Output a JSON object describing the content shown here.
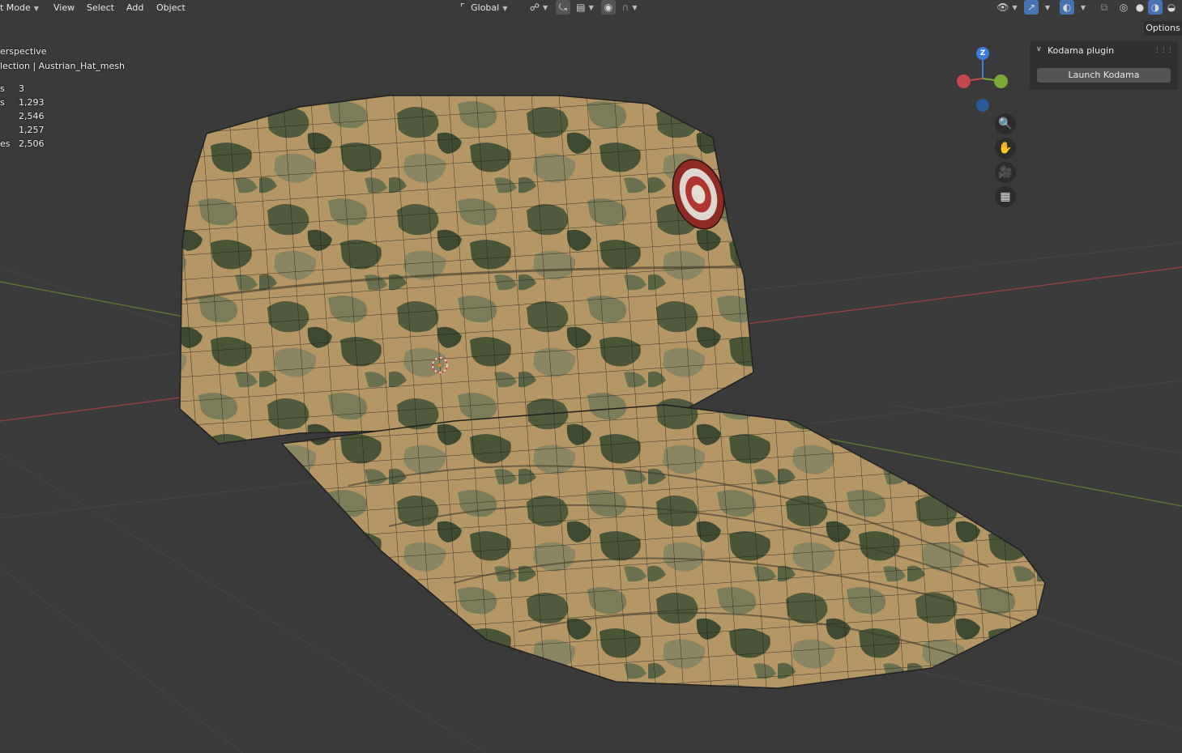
{
  "header": {
    "mode_label": "t Mode",
    "menus": [
      "View",
      "Select",
      "Add",
      "Object"
    ],
    "transform_orientation": "Global"
  },
  "viewport_info": {
    "view_name": "erspective",
    "collection_line": "lection | Austrian_Hat_mesh"
  },
  "stats": [
    {
      "label": "s",
      "value": "3"
    },
    {
      "label": "s",
      "value": "1,293"
    },
    {
      "label": "",
      "value": "2,546"
    },
    {
      "label": "",
      "value": "1,257"
    },
    {
      "label": "es",
      "value": "2,506"
    }
  ],
  "options_label": "Options",
  "panel": {
    "title": "Kodama plugin",
    "button": "Launch Kodama"
  },
  "gizmo": {
    "z_label": "Z"
  },
  "icons": {
    "navigation": [
      "zoom-icon",
      "hand-pan-icon",
      "camera-icon",
      "grid-ortho-icon"
    ]
  },
  "colors": {
    "background": "#3a3a3a",
    "x_axis": "#b5474e",
    "y_axis": "#7a9a3a",
    "z_axis": "#3a7fe0",
    "camo_tan": "#b89a6a",
    "camo_dark": "#4d5a3a",
    "camo_olive": "#7a7a55",
    "badge_red": "#a82b27"
  }
}
